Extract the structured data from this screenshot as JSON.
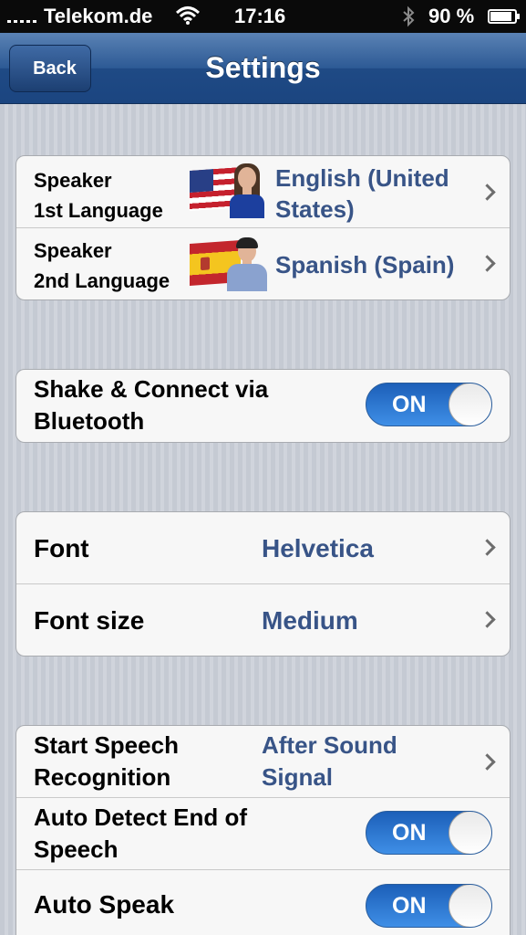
{
  "status_bar": {
    "carrier": "Telekom.de",
    "time": "17:16",
    "battery_percent": "90 %",
    "battery_level": 0.9,
    "icons": [
      "signal-icon",
      "wifi-icon",
      "bluetooth-icon",
      "battery-icon"
    ]
  },
  "nav": {
    "back_label": "Back",
    "title": "Settings"
  },
  "languages": [
    {
      "label_line1": "Speaker",
      "label_line2": "1st Language",
      "value_line1": "English (United",
      "value_line2": "States)",
      "flag": "us-flag-icon"
    },
    {
      "label_line1": "Speaker",
      "label_line2": "2nd Language",
      "value": "Spanish (Spain)",
      "flag": "spain-flag-icon"
    }
  ],
  "bluetooth": {
    "label_line1": "Shake & Connect via",
    "label_line2": "Bluetooth",
    "toggle": "ON"
  },
  "font_settings": [
    {
      "label": "Font",
      "value": "Helvetica"
    },
    {
      "label": "Font size",
      "value": "Medium"
    }
  ],
  "speech": {
    "start": {
      "label_line1": "Start Speech",
      "label_line2": "Recognition",
      "value_line1": "After Sound",
      "value_line2": "Signal"
    },
    "auto_detect": {
      "label_line1": "Auto Detect End of",
      "label_line2": "Speech",
      "toggle": "ON"
    },
    "auto_speak": {
      "label": "Auto Speak",
      "toggle": "ON"
    }
  },
  "colors": {
    "nav_blue": "#2d5a95",
    "value_blue": "#385487",
    "toggle_blue": "#2a77d4"
  }
}
